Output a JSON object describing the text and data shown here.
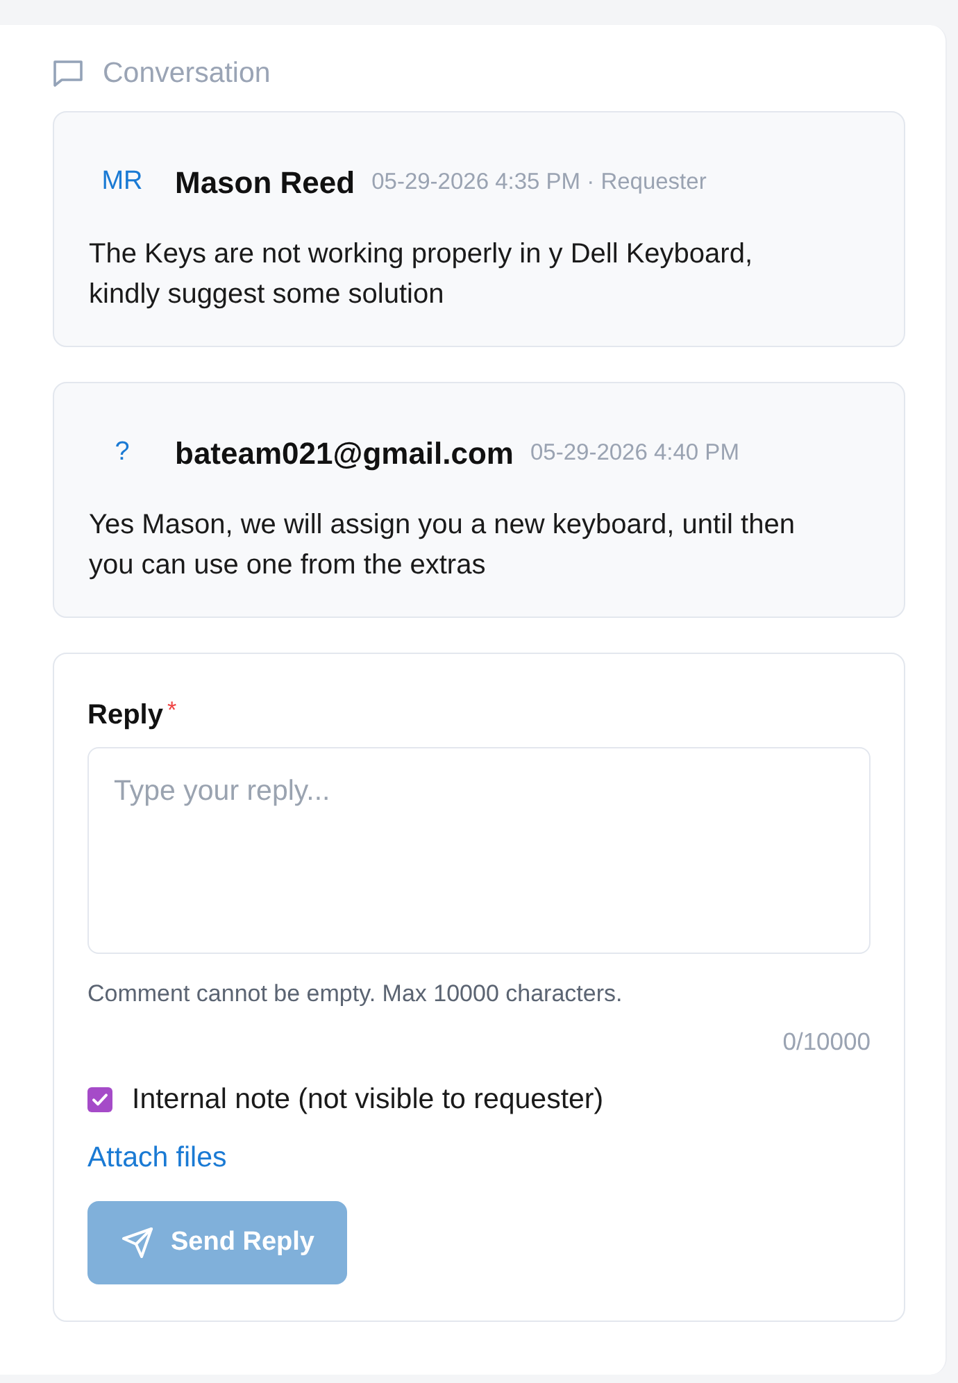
{
  "section": {
    "title": "Conversation"
  },
  "messages": [
    {
      "avatar": "MR",
      "author": "Mason Reed",
      "meta": "05-29-2026 4:35 PM · Requester",
      "body": "The Keys are not working properly in y Dell Keyboard, kindly suggest some solution"
    },
    {
      "avatar": "?",
      "author": "bateam021@gmail.com",
      "meta": "05-29-2026 4:40 PM",
      "body": "Yes Mason, we will assign you a new keyboard, until then you can use one from the extras"
    }
  ],
  "reply": {
    "label": "Reply",
    "required_mark": "*",
    "placeholder": "Type your reply...",
    "helper": "Comment cannot be empty. Max 10000 characters.",
    "counter": "0/10000",
    "internal_note": {
      "label": "Internal note (not visible to requester)",
      "checked": true
    },
    "attach_link": "Attach files",
    "send_button": {
      "label": "Send Reply",
      "disabled": true
    }
  }
}
